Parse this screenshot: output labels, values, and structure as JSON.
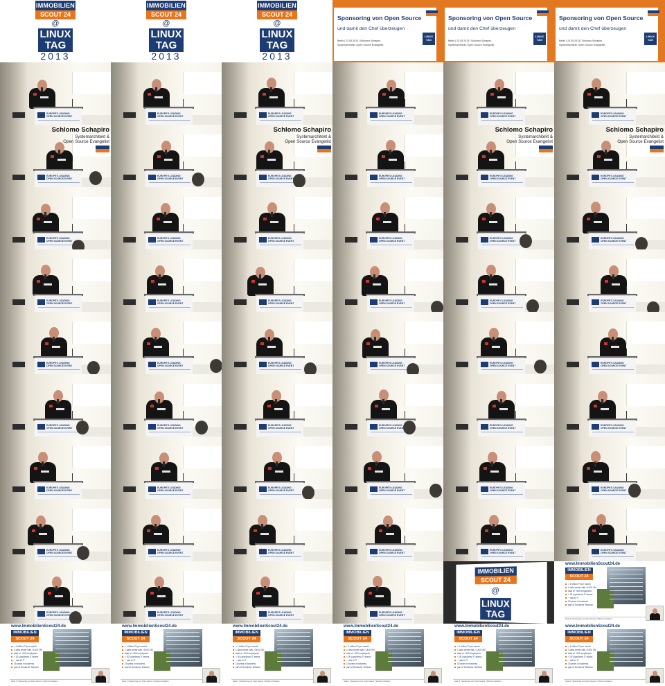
{
  "title_card": {
    "immobilien": "IMMOBILIEN",
    "scout": "SCOUT 24",
    "at": "@",
    "linux": "LINUX",
    "tag": "TAG",
    "year": "2013"
  },
  "title_slide": {
    "title": "Sponsoring von Open Source",
    "subtitle": "und damit den Chef überzeugen",
    "meta_line1": "Berlin | 23.05.2013 | Schlomo Schapiro",
    "meta_line2": "Systemarchitekt, Open Source Evangelist",
    "tag_box": "LINUX TAG"
  },
  "lower_third": {
    "name": "Schlomo Schapiro",
    "role_line1": "Systemarchitekt &",
    "role_line2": "Open Source Evangelist"
  },
  "podium": {
    "logo_text_line1": "EUROPE'S LEADING",
    "logo_text_line2": "OPEN SOURCE EVENT"
  },
  "company_slide": {
    "url": "www.ImmobilienScout24.de",
    "immobilien": "IMMOBILIEN",
    "scout": "SCOUT 24",
    "bullets": [
      "> 1 billion PI per month",
      "1 data center with >1400 VM",
      "total of ~600 employees",
      "< 30 (ops/devs) IT teams",
      "~ rate to IT",
      "15 years in business",
      "part of Deutsche Telekom"
    ],
    "footer": "Seite 3  |  Sponsoring von Open Source  |  Schlomo Schapiro"
  },
  "grid": {
    "columns": 6,
    "rows": 11,
    "layout": [
      [
        "logo",
        "logo",
        "logo",
        "orange",
        "orange",
        "orange"
      ],
      [
        "stage",
        "stage",
        "stage",
        "stage",
        "stage",
        "stage"
      ],
      [
        "stage-lt",
        "stage",
        "stage-lt",
        "stage",
        "stage-lt",
        "stage-lt"
      ],
      [
        "stage",
        "stage",
        "stage",
        "stage",
        "stage",
        "stage"
      ],
      [
        "stage",
        "stage",
        "stage",
        "stage",
        "stage",
        "stage"
      ],
      [
        "stage",
        "stage",
        "stage",
        "stage",
        "stage",
        "stage"
      ],
      [
        "stage",
        "stage",
        "stage",
        "stage",
        "stage",
        "stage"
      ],
      [
        "stage",
        "stage",
        "stage",
        "stage",
        "stage",
        "stage"
      ],
      [
        "stage",
        "stage",
        "stage",
        "stage",
        "stage",
        "stage"
      ],
      [
        "stage",
        "stage",
        "stage",
        "stage",
        "transition",
        "company"
      ],
      [
        "company",
        "company",
        "company",
        "company",
        "company",
        "company"
      ]
    ]
  },
  "colors": {
    "brand_blue": "#1d3c73",
    "brand_orange": "#e8751a",
    "slide_orange_bg": "#e2781f",
    "shirt": "#141414",
    "wall": "#f2ede2"
  }
}
